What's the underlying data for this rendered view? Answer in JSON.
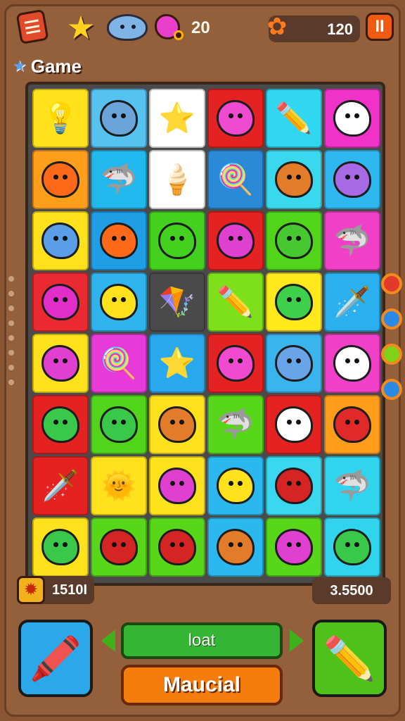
{
  "topbar": {
    "menu_icon": "menu-card-icon",
    "star_icon": "star-icon",
    "seal_icon": "seal-creature-icon",
    "blob_icon": "pink-blob-icon",
    "blob_count": "20",
    "gem_icon": "gem-cluster-icon",
    "score": "120",
    "pause_label": "II"
  },
  "title": {
    "text": "Game"
  },
  "board": {
    "rows": [
      [
        {
          "bg": "#ffe21c",
          "c": "#ff9e24",
          "g": "💡"
        },
        {
          "bg": "#55c2ef",
          "c": "#6aa4d8",
          "g": ""
        },
        {
          "bg": "#ffffff",
          "c": "",
          "g": "⭐"
        },
        {
          "bg": "#e52222",
          "c": "#f04ad0",
          "g": ""
        },
        {
          "bg": "#31d6f0",
          "c": "",
          "g": "✏️"
        },
        {
          "bg": "#f032c8",
          "c": "#ffffff",
          "g": ""
        }
      ],
      [
        {
          "bg": "#ff9e1a",
          "c": "#ff6a1a",
          "g": ""
        },
        {
          "bg": "#21b8ee",
          "c": "",
          "g": "🦈"
        },
        {
          "bg": "#ffffff",
          "c": "",
          "g": "🍦"
        },
        {
          "bg": "#2a8ad8",
          "c": "",
          "g": "🍭"
        },
        {
          "bg": "#3ad8ec",
          "c": "#e27b2a",
          "g": ""
        },
        {
          "bg": "#2eb8ef",
          "c": "#a86ae4",
          "g": ""
        }
      ],
      [
        {
          "bg": "#ffe21c",
          "c": "#5a9ee8",
          "g": ""
        },
        {
          "bg": "#1f9ee6",
          "c": "#ff6a1a",
          "g": ""
        },
        {
          "bg": "#44d01e",
          "c": "#44d01e",
          "g": ""
        },
        {
          "bg": "#e52222",
          "c": "#e040d0",
          "g": ""
        },
        {
          "bg": "#52d41a",
          "c": "#48c830",
          "g": ""
        },
        {
          "bg": "#f040c8",
          "c": "",
          "g": "🦈"
        }
      ],
      [
        {
          "bg": "#ea2a30",
          "c": "#e12ec9",
          "g": ""
        },
        {
          "bg": "#2fb4ee",
          "c": "#ffe21c",
          "g": ""
        },
        {
          "bg": "#4a4a4a",
          "c": "",
          "g": "🪁"
        },
        {
          "bg": "#7ee01a",
          "c": "",
          "g": "✏️"
        },
        {
          "bg": "#ffe91c",
          "c": "#3ed04a",
          "g": ""
        },
        {
          "bg": "#2ab0ee",
          "c": "",
          "g": "🗡️"
        }
      ],
      [
        {
          "bg": "#ffe21c",
          "c": "#e040d0",
          "g": ""
        },
        {
          "bg": "#e83ad8",
          "c": "",
          "g": "🍭"
        },
        {
          "bg": "#2aa8ee",
          "c": "",
          "g": "⭐"
        },
        {
          "bg": "#e52222",
          "c": "#f04ad0",
          "g": ""
        },
        {
          "bg": "#3ab4ec",
          "c": "#6aa4e8",
          "g": ""
        },
        {
          "bg": "#f040c8",
          "c": "#ffffff",
          "g": ""
        }
      ],
      [
        {
          "bg": "#e52222",
          "c": "#3ac84a",
          "g": ""
        },
        {
          "bg": "#52d41a",
          "c": "#3ac84a",
          "g": ""
        },
        {
          "bg": "#ffe21c",
          "c": "#e27b2a",
          "g": ""
        },
        {
          "bg": "#58d61a",
          "c": "",
          "g": "🦈"
        },
        {
          "bg": "#e52222",
          "c": "#ffffff",
          "g": ""
        },
        {
          "bg": "#ff9c1a",
          "c": "#e02a2a",
          "g": ""
        }
      ],
      [
        {
          "bg": "#e52222",
          "c": "",
          "g": "🗡️"
        },
        {
          "bg": "#ffe21c",
          "c": "",
          "g": "🌞"
        },
        {
          "bg": "#ffe21c",
          "c": "#e040d0",
          "g": ""
        },
        {
          "bg": "#2ab8ee",
          "c": "#ffe21c",
          "g": ""
        },
        {
          "bg": "#3ad8f0",
          "c": "#d42424",
          "g": ""
        },
        {
          "bg": "#31d4ee",
          "c": "",
          "g": "🦈"
        }
      ],
      [
        {
          "bg": "#ffe21c",
          "c": "#3ac84a",
          "g": ""
        },
        {
          "bg": "#58d61a",
          "c": "#d42424",
          "g": ""
        },
        {
          "bg": "#58d61a",
          "c": "#d42424",
          "g": ""
        },
        {
          "bg": "#2ab8ee",
          "c": "#e27b2a",
          "g": ""
        },
        {
          "bg": "#58d61a",
          "c": "#e040d0",
          "g": ""
        },
        {
          "bg": "#31d4ee",
          "c": "#3ac84a",
          "g": ""
        }
      ]
    ]
  },
  "stats": {
    "left_icon": "sun-badge-icon",
    "left_value": "1510I",
    "right_value": "3.5500"
  },
  "controls": {
    "left_tool_icon": "pink-pencil-icon",
    "right_tool_icon": "yellow-pencil-icon",
    "green_label": "loat",
    "orange_label": "Maucial"
  }
}
